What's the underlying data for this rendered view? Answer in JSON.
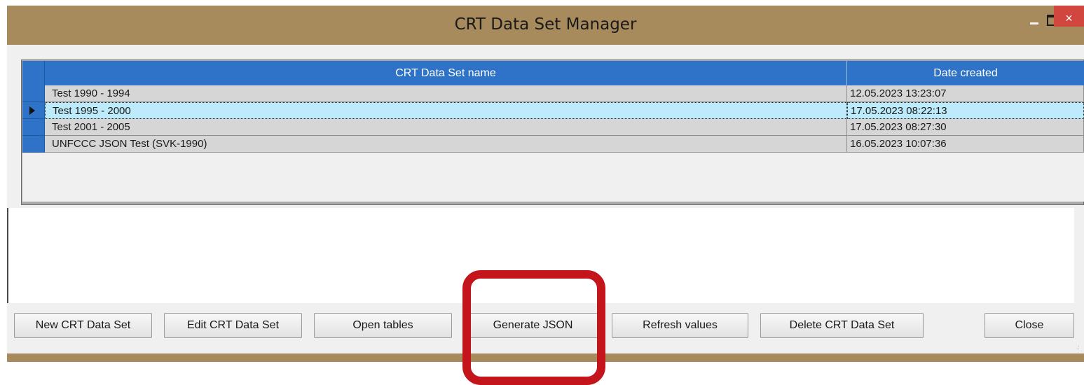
{
  "window": {
    "title": "CRT Data Set Manager",
    "minimize_icon": "minimize-icon",
    "maximize_icon": "maximize-icon",
    "close_glyph": "×"
  },
  "grid": {
    "columns": [
      "CRT Data Set name",
      "Date created"
    ],
    "rows": [
      {
        "name": "Test 1990 - 1994",
        "date": "12.05.2023 13:23:07",
        "selected": false
      },
      {
        "name": "Test 1995 - 2000",
        "date": "17.05.2023 08:22:13",
        "selected": true
      },
      {
        "name": "Test 2001 - 2005",
        "date": "17.05.2023 08:27:30",
        "selected": false
      },
      {
        "name": "UNFCCC JSON Test (SVK-1990)",
        "date": "16.05.2023 10:07:36",
        "selected": false
      }
    ]
  },
  "buttons": {
    "new": "New CRT Data Set",
    "edit": "Edit CRT Data Set",
    "open_tables": "Open tables",
    "generate_json": "Generate JSON",
    "refresh": "Refresh values",
    "delete": "Delete CRT Data Set",
    "close": "Close"
  },
  "colors": {
    "titlebar": "#a88b5c",
    "grid_header": "#2e73c7",
    "selected_row": "#bdebfb",
    "highlight": "#c4141c",
    "close_button": "#d1473f"
  }
}
